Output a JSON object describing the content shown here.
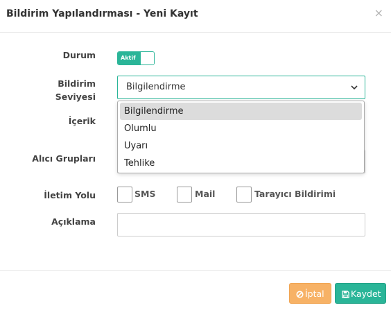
{
  "modal": {
    "title": "Bildirim Yapılandırması - Yeni Kayıt",
    "close_symbol": "×"
  },
  "form": {
    "status_label": "Durum",
    "status_toggle": {
      "label": "Aktif",
      "checked": true,
      "color": "#2ab598"
    },
    "level_label_line1": "Bildirim",
    "level_label_line2": "Seviyesi",
    "level_select": {
      "value": "Bilgilendirme",
      "options": [
        "Bilgilendirme",
        "Olumlu",
        "Uyarı",
        "Tehlike"
      ]
    },
    "content_label": "İçerik",
    "recipients_label": "Alıcı Grupları",
    "channel_label": "İletim Yolu",
    "channels": [
      {
        "label": "SMS",
        "checked": false
      },
      {
        "label": "Mail",
        "checked": false
      },
      {
        "label": "Tarayıcı Bildirimi",
        "checked": false
      }
    ],
    "description_label": "Açıklama",
    "description_value": ""
  },
  "footer": {
    "cancel_label": "İptal",
    "save_label": "Kaydet",
    "cancel_color": "#f7b266",
    "save_color": "#2ab598"
  },
  "icons": {
    "cancel": "ban-icon",
    "save": "floppy-disk-icon",
    "select_arrow": "chevron-down-icon",
    "close": "close-icon"
  }
}
